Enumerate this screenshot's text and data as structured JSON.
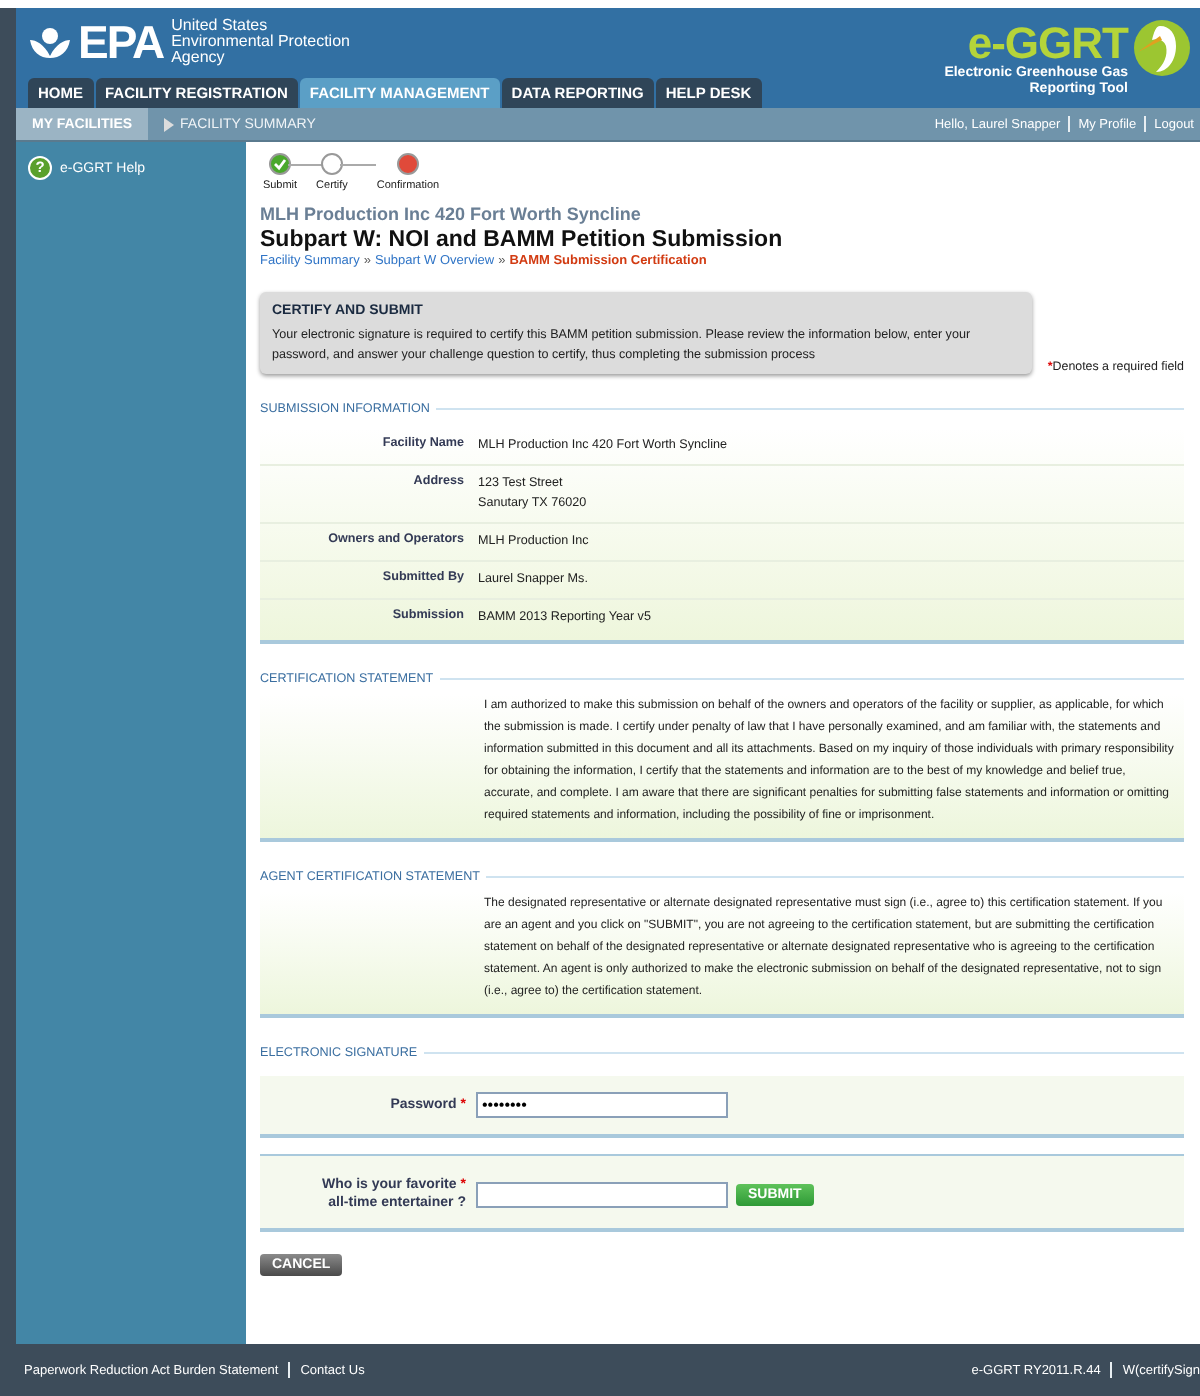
{
  "header": {
    "logo": "EPA",
    "agency_lines": [
      "United States",
      "Environmental Protection",
      "Agency"
    ],
    "app_logo": "e-GGRT",
    "app_subtitle_lines": [
      "Electronic Greenhouse Gas",
      "Reporting Tool"
    ]
  },
  "tabs": [
    {
      "label": "HOME",
      "selected": false
    },
    {
      "label": "FACILITY REGISTRATION",
      "selected": false
    },
    {
      "label": "FACILITY MANAGEMENT",
      "selected": true
    },
    {
      "label": "DATA REPORTING",
      "selected": false
    },
    {
      "label": "HELP DESK",
      "selected": false
    }
  ],
  "subnav": {
    "items": [
      {
        "label": "MY FACILITIES",
        "selected": true
      },
      {
        "label": "FACILITY SUMMARY",
        "selected": false
      }
    ],
    "greeting": "Hello, Laurel Snapper",
    "links": [
      "My Profile",
      "Logout"
    ]
  },
  "sidebar": {
    "items": [
      {
        "icon": "?",
        "label": "e-GGRT Help"
      }
    ]
  },
  "steps": [
    {
      "label": "Submit",
      "complete": true,
      "error": false
    },
    {
      "label": "Certify",
      "complete": false,
      "error": false
    },
    {
      "label": "Confirmation",
      "complete": false,
      "error": true
    }
  ],
  "facility_name": "MLH Production Inc 420 Fort Worth Syncline",
  "page_title": "Subpart W: NOI and BAMM Petition Submission",
  "breadcrumbs": [
    {
      "label": "Facility Summary",
      "current": false
    },
    {
      "separator": "»",
      "label": "Subpart W Overview",
      "current": false
    },
    {
      "separator": "»",
      "label": "BAMM Submission Certification",
      "current": true
    }
  ],
  "notice": {
    "title": "CERTIFY AND SUBMIT",
    "text": "Your electronic signature is required to certify this BAMM petition submission. Please review the information below, enter your password, and answer your challenge question to certify, thus completing the submission process"
  },
  "required_note": {
    "mark": "*",
    "text": "Denotes a required field"
  },
  "submission_info": {
    "title": "SUBMISSION INFORMATION",
    "rows": [
      {
        "label": "Facility Name",
        "lines": [
          "MLH Production Inc 420 Fort Worth Syncline"
        ]
      },
      {
        "label": "Address",
        "lines": [
          "123 Test Street",
          "Sanutary TX 76020"
        ]
      },
      {
        "label": "Owners and Operators",
        "lines": [
          "MLH Production Inc"
        ]
      },
      {
        "label": "Submitted By",
        "lines": [
          "Laurel Snapper Ms."
        ]
      },
      {
        "label": "Submission",
        "lines": [
          "BAMM 2013 Reporting Year v5"
        ]
      }
    ]
  },
  "statements": [
    {
      "title": "CERTIFICATION STATEMENT",
      "text": "I am authorized to make this submission on behalf of the owners and operators of the facility or supplier, as applicable, for which the submission is made. I certify under penalty of law that I have personally examined, and am familiar with, the statements and information submitted in this document and all its attachments. Based on my inquiry of those individuals with primary responsibility for obtaining the information, I certify that the statements and information are to the best of my knowledge and belief true, accurate, and complete. I am aware that there are significant penalties for submitting false statements and information or omitting required statements and information, including the possibility of fine or imprisonment."
    },
    {
      "title": "AGENT CERTIFICATION STATEMENT",
      "text": "The designated representative or alternate designated representative must sign (i.e., agree to) this certification statement. If you are an agent and you click on \"SUBMIT\", you are not agreeing to the certification statement, but are submitting the certification statement on behalf of the designated representative or alternate designated representative who is agreeing to the certification statement. An agent is only authorized to make the electronic submission on behalf of the designated representative, not to sign (i.e., agree to) the certification statement."
    }
  ],
  "signature": {
    "title": "ELECTRONIC SIGNATURE",
    "password": {
      "label": "Password",
      "required": true,
      "value": "••••••••"
    },
    "question": {
      "label_lines": [
        "Who is your favorite",
        "all-time entertainer ?"
      ],
      "required": true
    },
    "submit": "SUBMIT",
    "cancel": "CANCEL"
  },
  "footer": {
    "links": [
      "Paperwork Reduction Act Burden Statement",
      "Contact Us"
    ],
    "right": [
      "e-GGRT RY2011.R.44",
      "W(certifySign"
    ]
  }
}
